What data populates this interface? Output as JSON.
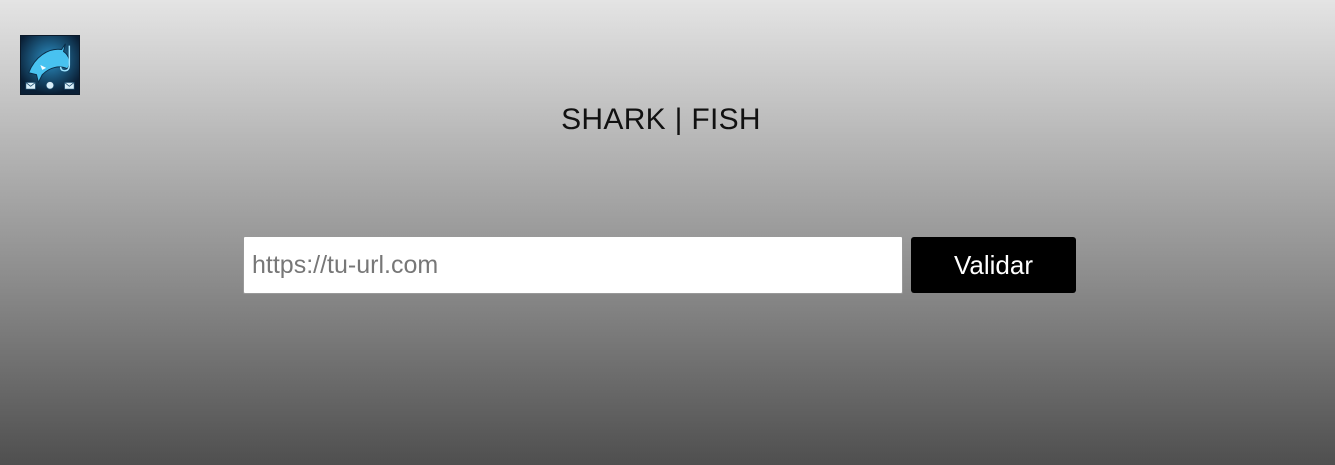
{
  "header": {
    "logo_icon": "shark-phishing-logo-icon",
    "title": "SHARK | FISH"
  },
  "form": {
    "url_placeholder": "https://tu-url.com",
    "url_value": "",
    "submit_label": "Validar"
  },
  "colors": {
    "button_background": "#000000",
    "button_text": "#ffffff",
    "logo_accent": "#3fb6e6"
  }
}
